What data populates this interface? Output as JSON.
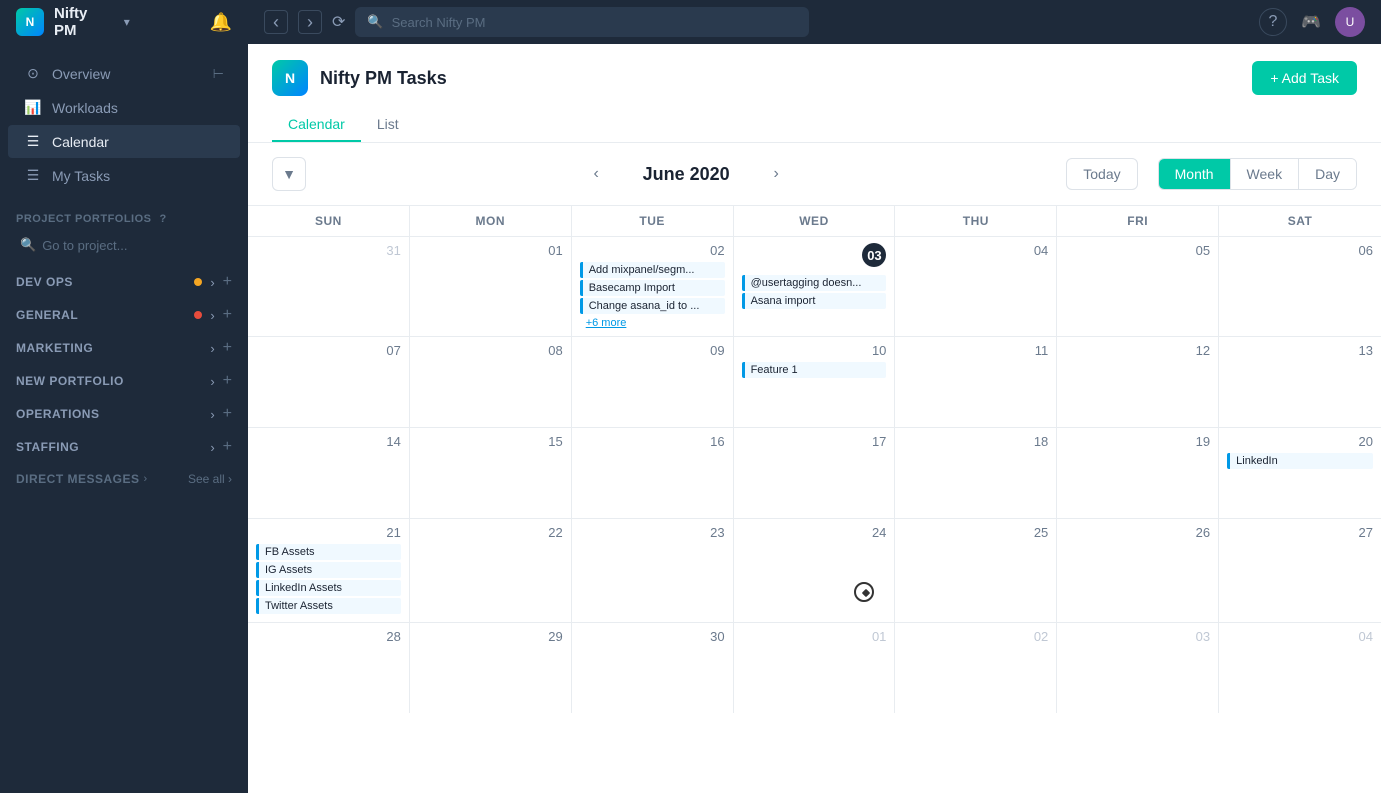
{
  "app": {
    "name": "Nifty PM",
    "dropdown_arrow": "▾"
  },
  "topbar": {
    "back_icon": "‹",
    "forward_icon": "›",
    "history_icon": "⌕",
    "search_placeholder": "Search Nifty PM",
    "help_icon": "?",
    "avatar_initials": "U"
  },
  "sidebar": {
    "overview_label": "Overview",
    "workloads_label": "Workloads",
    "calendar_label": "Calendar",
    "my_tasks_label": "My Tasks",
    "portfolios_section": "PROJECT PORTFOLIOS",
    "portfolios_search": "Go to project...",
    "groups": [
      {
        "name": "DEV OPS",
        "has_dot": true,
        "dot_color": "orange"
      },
      {
        "name": "GENERAL",
        "has_dot": true,
        "dot_color": "red"
      },
      {
        "name": "MARKETING",
        "has_dot": false
      },
      {
        "name": "NEW PORTFOLIO",
        "has_dot": false
      },
      {
        "name": "OPERATIONS",
        "has_dot": false
      },
      {
        "name": "STAFFING",
        "has_dot": false
      }
    ],
    "direct_messages_label": "DIRECT MESSAGES",
    "see_all_label": "See all ›"
  },
  "project": {
    "title": "Nifty PM Tasks",
    "add_task_label": "+ Add Task"
  },
  "tabs": [
    {
      "label": "Calendar",
      "active": true
    },
    {
      "label": "List",
      "active": false
    }
  ],
  "calendar_toolbar": {
    "filter_icon": "⊟",
    "prev_icon": "‹",
    "next_icon": "›",
    "month_year": "June 2020",
    "today_label": "Today",
    "view_month": "Month",
    "view_week": "Week",
    "view_day": "Day"
  },
  "calendar_headers": [
    "SUN",
    "MON",
    "TUE",
    "WED",
    "THU",
    "FRI",
    "SAT"
  ],
  "calendar_weeks": [
    {
      "days": [
        {
          "date": "31",
          "other_month": true,
          "tasks": []
        },
        {
          "date": "01",
          "tasks": []
        },
        {
          "date": "02",
          "tasks": [
            "Add mixpanel/segm...",
            "Basecamp Import",
            "Change asana_id to ..."
          ],
          "more": "+6 more"
        },
        {
          "date": "03",
          "today": true,
          "tasks": [
            "@usertagging doesn...",
            "Asana import"
          ]
        },
        {
          "date": "04",
          "tasks": []
        },
        {
          "date": "05",
          "tasks": []
        },
        {
          "date": "06",
          "tasks": []
        }
      ]
    },
    {
      "days": [
        {
          "date": "07",
          "tasks": []
        },
        {
          "date": "08",
          "tasks": []
        },
        {
          "date": "09",
          "tasks": []
        },
        {
          "date": "10",
          "tasks": [
            "Feature 1"
          ]
        },
        {
          "date": "11",
          "tasks": []
        },
        {
          "date": "12",
          "tasks": []
        },
        {
          "date": "13",
          "tasks": []
        }
      ]
    },
    {
      "days": [
        {
          "date": "14",
          "tasks": []
        },
        {
          "date": "15",
          "tasks": []
        },
        {
          "date": "16",
          "tasks": []
        },
        {
          "date": "17",
          "tasks": []
        },
        {
          "date": "18",
          "tasks": []
        },
        {
          "date": "19",
          "tasks": []
        },
        {
          "date": "20",
          "tasks": [
            "LinkedIn"
          ]
        }
      ]
    },
    {
      "days": [
        {
          "date": "21",
          "tasks": [
            "FB Assets",
            "IG Assets",
            "LinkedIn Assets",
            "Twitter Assets"
          ]
        },
        {
          "date": "22",
          "tasks": []
        },
        {
          "date": "23",
          "tasks": []
        },
        {
          "date": "24",
          "tasks": [],
          "cursor": true
        },
        {
          "date": "25",
          "tasks": []
        },
        {
          "date": "26",
          "tasks": []
        },
        {
          "date": "27",
          "tasks": []
        }
      ]
    },
    {
      "days": [
        {
          "date": "28",
          "tasks": []
        },
        {
          "date": "29",
          "tasks": []
        },
        {
          "date": "30",
          "tasks": []
        },
        {
          "date": "01",
          "other_month": true,
          "tasks": []
        },
        {
          "date": "02",
          "other_month": true,
          "tasks": []
        },
        {
          "date": "03",
          "other_month": true,
          "tasks": []
        },
        {
          "date": "04",
          "other_month": true,
          "tasks": []
        }
      ]
    }
  ]
}
